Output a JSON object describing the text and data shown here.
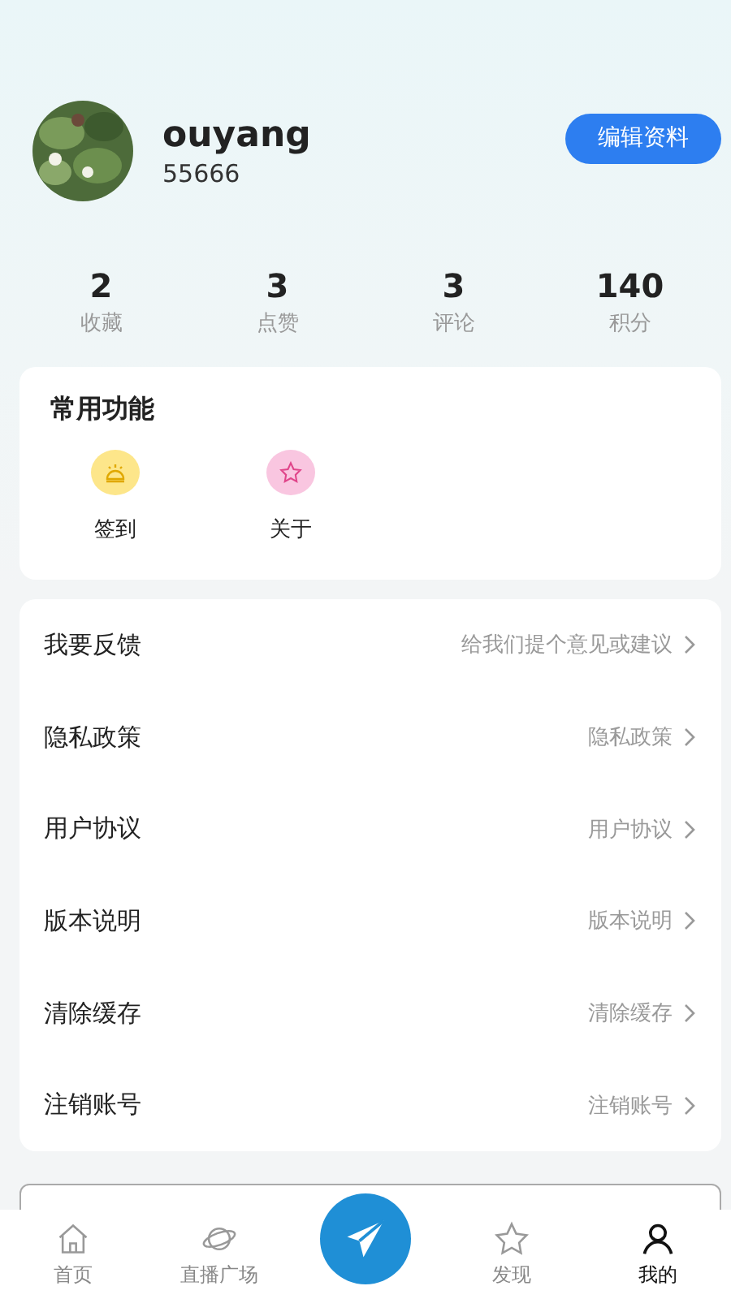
{
  "profile": {
    "name": "ouyang",
    "id": "55666",
    "edit_button": "编辑资料"
  },
  "stats": [
    {
      "value": "2",
      "label": "收藏"
    },
    {
      "value": "3",
      "label": "点赞"
    },
    {
      "value": "3",
      "label": "评论"
    },
    {
      "value": "140",
      "label": "积分"
    }
  ],
  "functions": {
    "title": "常用功能",
    "items": [
      {
        "label": "签到",
        "kind": "checkin",
        "color": "#fde68a"
      },
      {
        "label": "关于",
        "kind": "about",
        "color": "#f9c6e0"
      }
    ]
  },
  "menu": [
    {
      "label": "我要反馈",
      "hint": "给我们提个意见或建议"
    },
    {
      "label": "隐私政策",
      "hint": "隐私政策"
    },
    {
      "label": "用户协议",
      "hint": "用户协议"
    },
    {
      "label": "版本说明",
      "hint": "版本说明"
    },
    {
      "label": "清除缓存",
      "hint": "清除缓存"
    },
    {
      "label": "注销账号",
      "hint": "注销账号"
    }
  ],
  "tabs": [
    {
      "label": "首页",
      "kind": "home",
      "selected": false
    },
    {
      "label": "直播广场",
      "kind": "planet",
      "selected": false
    },
    {
      "kind": "send",
      "selected": false
    },
    {
      "label": "发现",
      "kind": "star",
      "selected": false
    },
    {
      "label": "我的",
      "kind": "user",
      "selected": true
    }
  ]
}
